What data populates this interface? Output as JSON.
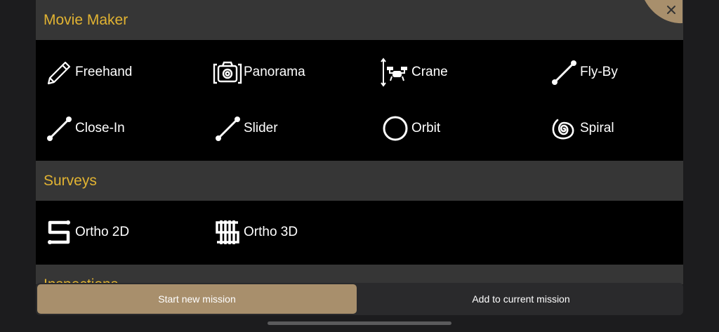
{
  "movie_maker": {
    "title": "Movie Maker",
    "items": [
      {
        "label": "Freehand",
        "icon": "pencil-icon"
      },
      {
        "label": "Panorama",
        "icon": "camera-icon"
      },
      {
        "label": "Crane",
        "icon": "drone-crane-icon"
      },
      {
        "label": "Fly-By",
        "icon": "line-icon"
      },
      {
        "label": "Close-In",
        "icon": "line-icon"
      },
      {
        "label": "Slider",
        "icon": "line-icon"
      },
      {
        "label": "Orbit",
        "icon": "circle-icon"
      },
      {
        "label": "Spiral",
        "icon": "spiral-icon"
      }
    ]
  },
  "surveys": {
    "title": "Surveys",
    "items": [
      {
        "label": "Ortho 2D",
        "icon": "ortho-2d-icon"
      },
      {
        "label": "Ortho 3D",
        "icon": "ortho-3d-icon"
      }
    ]
  },
  "inspections": {
    "title": "Inspections"
  },
  "actions": {
    "start_label": "Start new mission",
    "add_label": "Add to current mission"
  },
  "colors": {
    "accent": "#e1b332",
    "start_button": "#a88f6c",
    "header_bg": "#363636"
  }
}
